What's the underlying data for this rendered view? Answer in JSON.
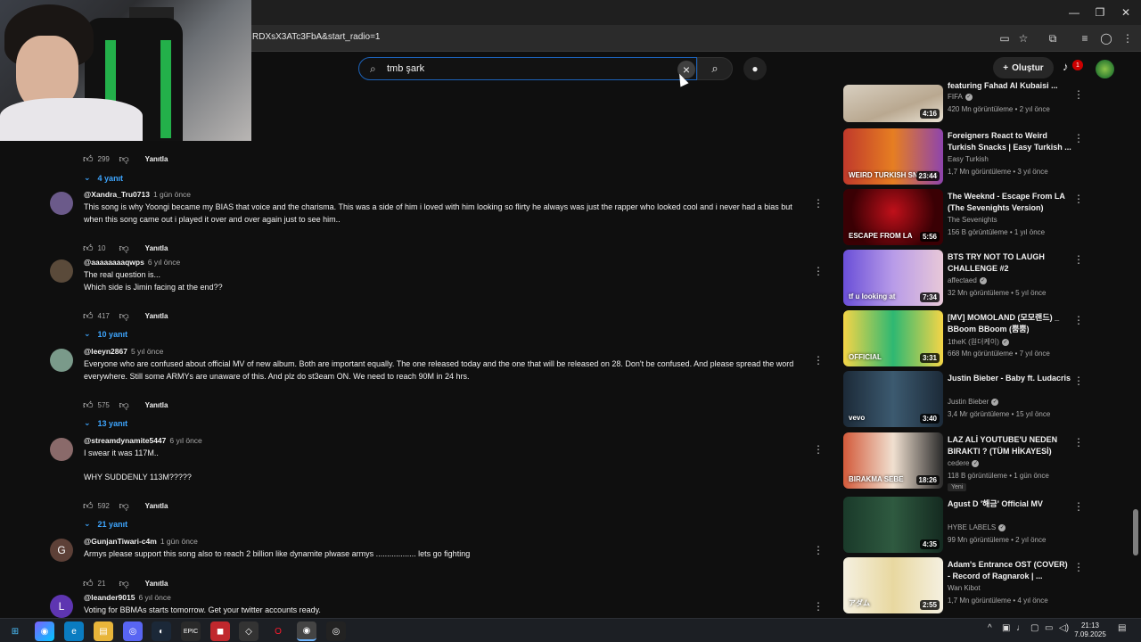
{
  "browser": {
    "url": "RDXsX3ATc3FbA&start_radio=1",
    "window_controls": [
      "—",
      "❐",
      "✕"
    ]
  },
  "header": {
    "search_value": "tmb şark",
    "create_label": "Oluştur",
    "notification_count": "1"
  },
  "comments": [
    {
      "author": "",
      "time": "",
      "text": "",
      "likes": "299",
      "reply_label": "Yanıtla",
      "replies": "4 yanıt",
      "avatar_color": "#4a4a4a",
      "avatar_letter": ""
    },
    {
      "author": "@Xandra_Tru0713",
      "time": "1 gün önce",
      "text": "This song is why Yoongi became my BIAS that voice and the charisma. This was a side of him i loved with him looking so flirty he always was just the rapper who looked cool and i never had a bias but when this song came out i played it over and over again just to see him..",
      "likes": "10",
      "reply_label": "Yanıtla",
      "replies": "",
      "avatar_color": "#6b5a8a",
      "avatar_letter": ""
    },
    {
      "author": "@aaaaaaaaqwps",
      "time": "6 yıl önce",
      "text": "The real question is...\nWhich side is Jimin facing at the end??",
      "likes": "417",
      "reply_label": "Yanıtla",
      "replies": "10 yanıt",
      "avatar_color": "#5a4a3a",
      "avatar_letter": ""
    },
    {
      "author": "@leeyn2867",
      "time": "5 yıl önce",
      "text": "Everyone who are confused about official MV of new album. Both are important equally. The one released today and the one that will be released on 28. Don't be confused. And please spread the word everywhere. Still some ARMYs are unaware of this. And plz do st3eam ON. We need to reach 90M in 24 hrs.",
      "likes": "575",
      "reply_label": "Yanıtla",
      "replies": "13 yanıt",
      "avatar_color": "#7a9a8a",
      "avatar_letter": ""
    },
    {
      "author": "@streamdynamite5447",
      "time": "6 yıl önce",
      "text": "I swear it was 117M..\n\nWHY SUDDENLY 113M?????",
      "likes": "592",
      "reply_label": "Yanıtla",
      "replies": "21 yanıt",
      "avatar_color": "#8a6a6a",
      "avatar_letter": ""
    },
    {
      "author": "@GunjanTiwari-c4m",
      "time": "1 gün önce",
      "text": "Armys  please support this song  also to reach 2 billion like  dynamite plwase armys .................. lets go fighting",
      "likes": "21",
      "reply_label": "Yanıtla",
      "replies": "",
      "avatar_color": "#5d4037",
      "avatar_letter": "G"
    },
    {
      "author": "@leander9015",
      "time": "6 yıl önce",
      "text": "Voting for BBMAs starts tomorrow. Get your twitter accounts ready.",
      "likes": "",
      "reply_label": "",
      "replies": "",
      "avatar_color": "#5e35b1",
      "avatar_letter": "L"
    }
  ],
  "sidebar": [
    {
      "title": "featuring Fahad Al Kubaisi ...",
      "channel": "FIFA",
      "verified": true,
      "meta": "420 Mn görüntüleme • 2 yıl önce",
      "duration": "4:16",
      "thumb": "linear-gradient(160deg,#d8cfc0,#b9a890 60%,#e9e2d4)",
      "new": ""
    },
    {
      "title": "Foreigners React to Weird Turkish Snacks | Easy Turkish ...",
      "channel": "Easy Turkish",
      "verified": false,
      "meta": "1,7 Mn görüntüleme • 3 yıl önce",
      "duration": "23:44",
      "thumb": "linear-gradient(90deg,#c0392b,#e67e22 50%,#8e44ad)",
      "new": "",
      "thumb_text": "WEIRD TURKISH SNACKS"
    },
    {
      "title": "The Weeknd - Escape From LA (The Sevenights Version)",
      "channel": "The Sevenights",
      "verified": false,
      "meta": "156 B görüntüleme • 1 yıl önce",
      "duration": "5:56",
      "thumb": "radial-gradient(circle at 50% 40%,#c0101a,#3a0004 70%)",
      "new": "",
      "thumb_text": "ESCAPE FROM LA"
    },
    {
      "title": "BTS TRY NOT TO LAUGH CHALLENGE #2",
      "channel": "affectaed",
      "verified": true,
      "meta": "32 Mn görüntüleme • 5 yıl önce",
      "duration": "7:34",
      "thumb": "linear-gradient(90deg,#6a4fd8,#b89be8 50%,#e8c8d8)",
      "new": "",
      "thumb_text": "tf u looking at"
    },
    {
      "title": "[MV] MOMOLAND (모모랜드) _ BBoom BBoom (뿜뿜)",
      "channel": "1theK (원더케이)",
      "verified": true,
      "meta": "668 Mn görüntüleme • 7 yıl önce",
      "duration": "3:31",
      "thumb": "linear-gradient(90deg,#f5d547,#2eb872 50%,#f5d547)",
      "new": "",
      "thumb_text": "OFFICIAL"
    },
    {
      "title": "Justin Bieber - Baby ft. Ludacris",
      "channel": "Justin Bieber",
      "verified": true,
      "meta": "3,4 Mr görüntüleme • 15 yıl önce",
      "duration": "3:40",
      "thumb": "linear-gradient(90deg,#1c2a38,#3c5a70 50%,#1c2a38)",
      "new": "",
      "thumb_text": "vevo"
    },
    {
      "title": "LAZ ALİ YOUTUBE'U NEDEN BIRAKTI ? (TÜM HİKAYESİ)",
      "channel": "cedere",
      "verified": true,
      "meta": "118 B görüntüleme • 1 gün önce",
      "duration": "18:26",
      "thumb": "linear-gradient(90deg,#d35a3a,#f0e0d0 50%,#2a2a2a)",
      "new": "Yeni",
      "thumb_text": "BIRAKMA SEBE"
    },
    {
      "title": "Agust D '해금' Official MV",
      "channel": "HYBE LABELS",
      "verified": true,
      "meta": "99 Mn görüntüleme • 2 yıl önce",
      "duration": "4:35",
      "thumb": "linear-gradient(90deg,#1a3a2a,#2f5a40 50%,#142a20)",
      "new": ""
    },
    {
      "title": "Adam's Entrance OST (COVER) - Record of Ragnarok | ...",
      "channel": "Wan Kibot",
      "verified": false,
      "meta": "1,7 Mn görüntüleme • 4 yıl önce",
      "duration": "2:55",
      "thumb": "linear-gradient(90deg,#f5f0e0,#e8d8a0 50%,#f5f0e0)",
      "new": "",
      "thumb_text": "アダム"
    }
  ],
  "taskbar": {
    "time": "21:13",
    "date": "7.09.2025"
  }
}
